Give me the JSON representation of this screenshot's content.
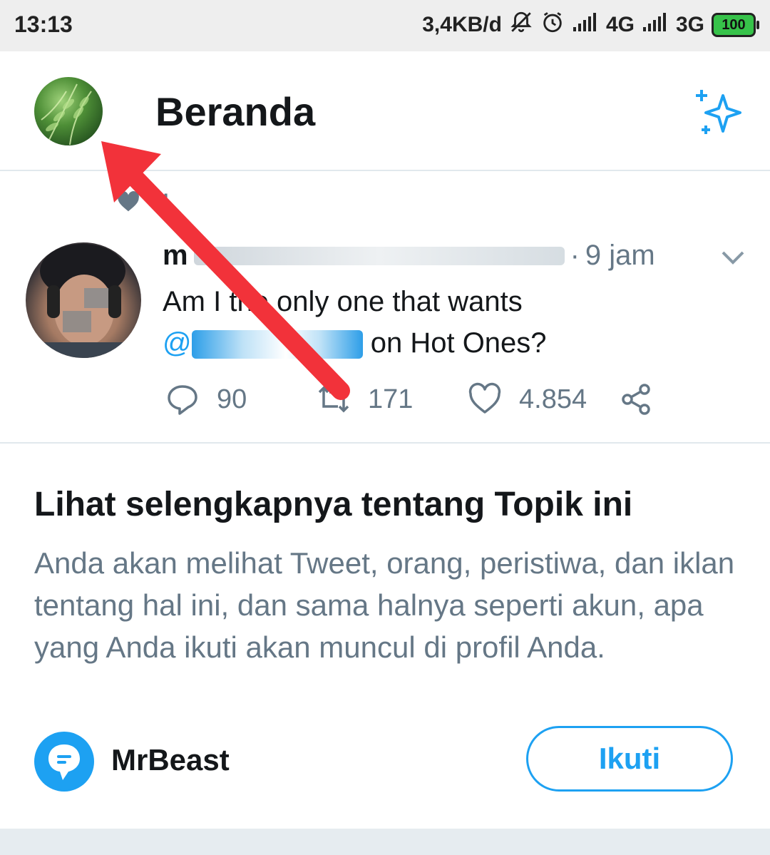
{
  "status_bar": {
    "time": "13:13",
    "speed": "3,4KB/d",
    "network1": "4G",
    "network2": "3G",
    "battery": "100"
  },
  "header": {
    "title": "Beranda"
  },
  "tweet": {
    "social_context": "M",
    "author": "m",
    "separator": "·",
    "time": "9 jam",
    "text_line1": "Am I the only one that wants",
    "mention_prefix": "@",
    "text_line2": " on Hot Ones?",
    "replies": "90",
    "retweets": "171",
    "likes": "4.854"
  },
  "topic_card": {
    "title": "Lihat selengkapnya tentang Topik ini",
    "description": "Anda akan melihat Tweet, orang, peristiwa, dan iklan tentang hal ini, dan sama halnya seperti akun, apa yang Anda ikuti akan muncul di profil Anda.",
    "topic_name": "MrBeast",
    "follow_label": "Ikuti"
  },
  "colors": {
    "accent": "#1da1f2",
    "arrow": "#f2323a",
    "secondary_text": "#657786"
  },
  "icons": [
    "notifications-off-icon",
    "alarm-icon",
    "signal-icon",
    "battery-icon",
    "sparkle-icon",
    "heart-icon",
    "chevron-down-icon",
    "reply-icon",
    "retweet-icon",
    "like-icon",
    "share-icon",
    "topic-icon"
  ]
}
